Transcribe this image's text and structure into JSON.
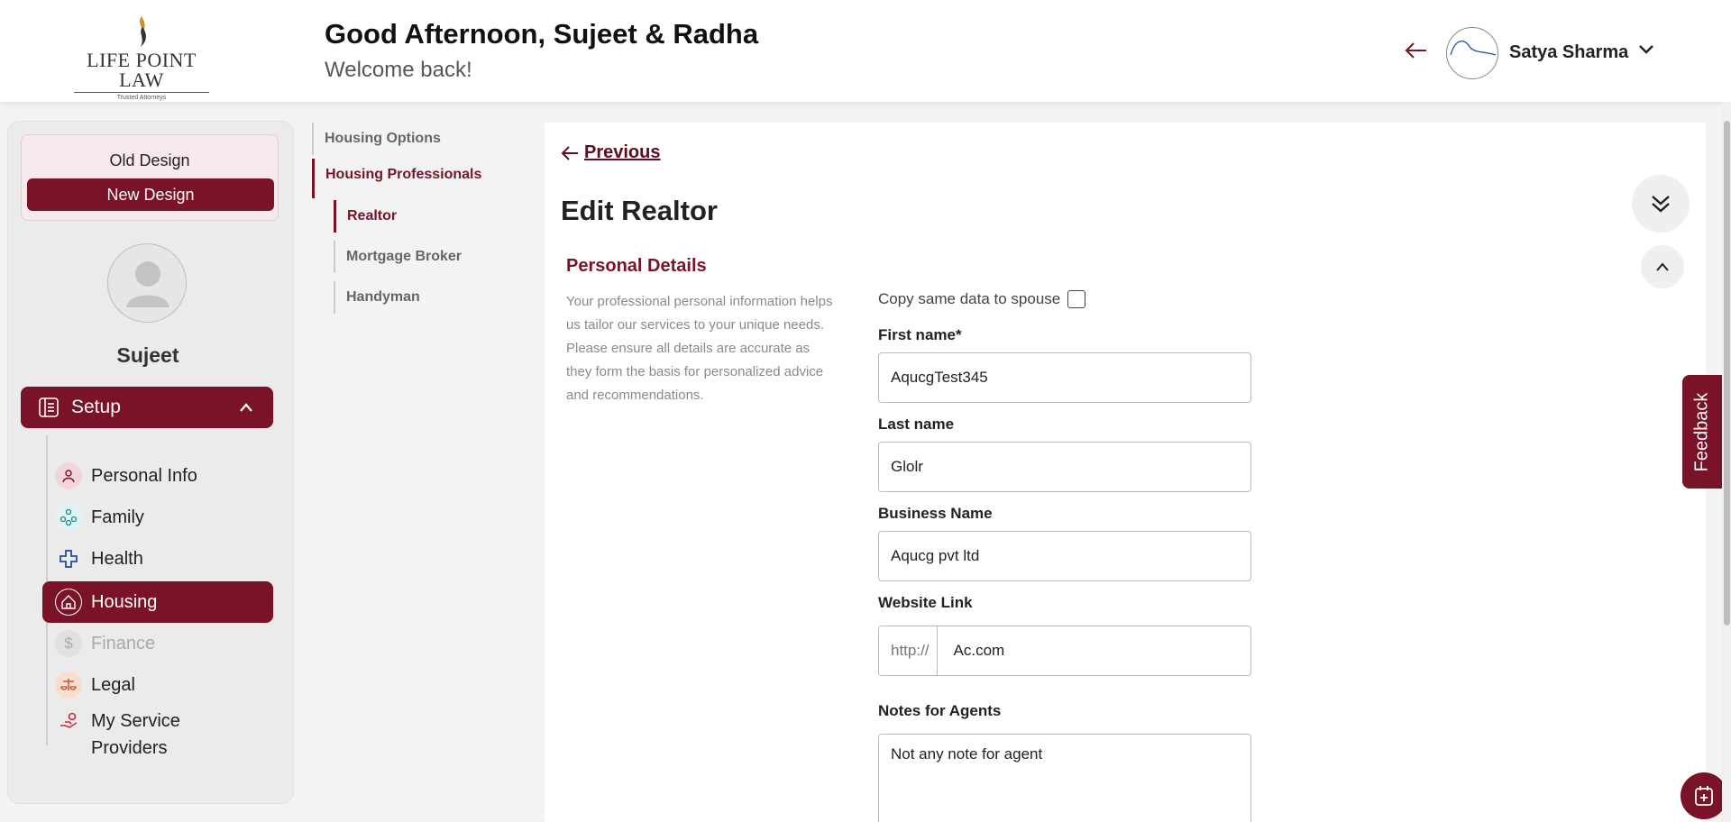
{
  "brand": {
    "name": "LIFE POINT LAW",
    "tagline": "Trusted Attorneys"
  },
  "header": {
    "greeting": "Good Afternoon, Sujeet & Radha",
    "subtitle": "Welcome back!",
    "user_name": "Satya Sharma"
  },
  "sidebar": {
    "old_design": "Old Design",
    "new_design": "New Design",
    "profile_name": "Sujeet",
    "setup_label": "Setup",
    "items": [
      {
        "label": "Personal Info",
        "icon": "person-icon"
      },
      {
        "label": "Family",
        "icon": "family-icon"
      },
      {
        "label": "Health",
        "icon": "health-cross-icon"
      },
      {
        "label": "Housing",
        "icon": "house-icon",
        "active": true
      },
      {
        "label": "Finance",
        "icon": "dollar-icon",
        "disabled": true
      },
      {
        "label": "Legal",
        "icon": "scales-icon"
      },
      {
        "label": "My Service Providers",
        "icon": "service-hand-icon"
      }
    ]
  },
  "subnav": {
    "housing_options": "Housing Options",
    "housing_professionals": "Housing Professionals",
    "realtor": "Realtor",
    "mortgage_broker": "Mortgage Broker",
    "handyman": "Handyman"
  },
  "form": {
    "previous": "Previous",
    "title": "Edit Realtor",
    "section_title": "Personal Details",
    "section_desc": "Your professional personal information helps us tailor our services to your unique needs. Please ensure all details are accurate as they form the basis for personalized advice and recommendations.",
    "copy_label": "Copy same data to spouse",
    "first_name_label": "First name*",
    "first_name_value": "AqucgTest345",
    "last_name_label": "Last name",
    "last_name_value": "Glolr",
    "business_label": "Business Name",
    "business_value": "Aqucg pvt ltd",
    "website_label": "Website Link",
    "website_prefix": "http://",
    "website_value": "Ac.com",
    "notes_label": "Notes for Agents",
    "notes_value": "Not any note for agent"
  },
  "feedback_label": "Feedback",
  "colors": {
    "brand": "#7a1228",
    "accent_text": "#5b0e1f"
  }
}
